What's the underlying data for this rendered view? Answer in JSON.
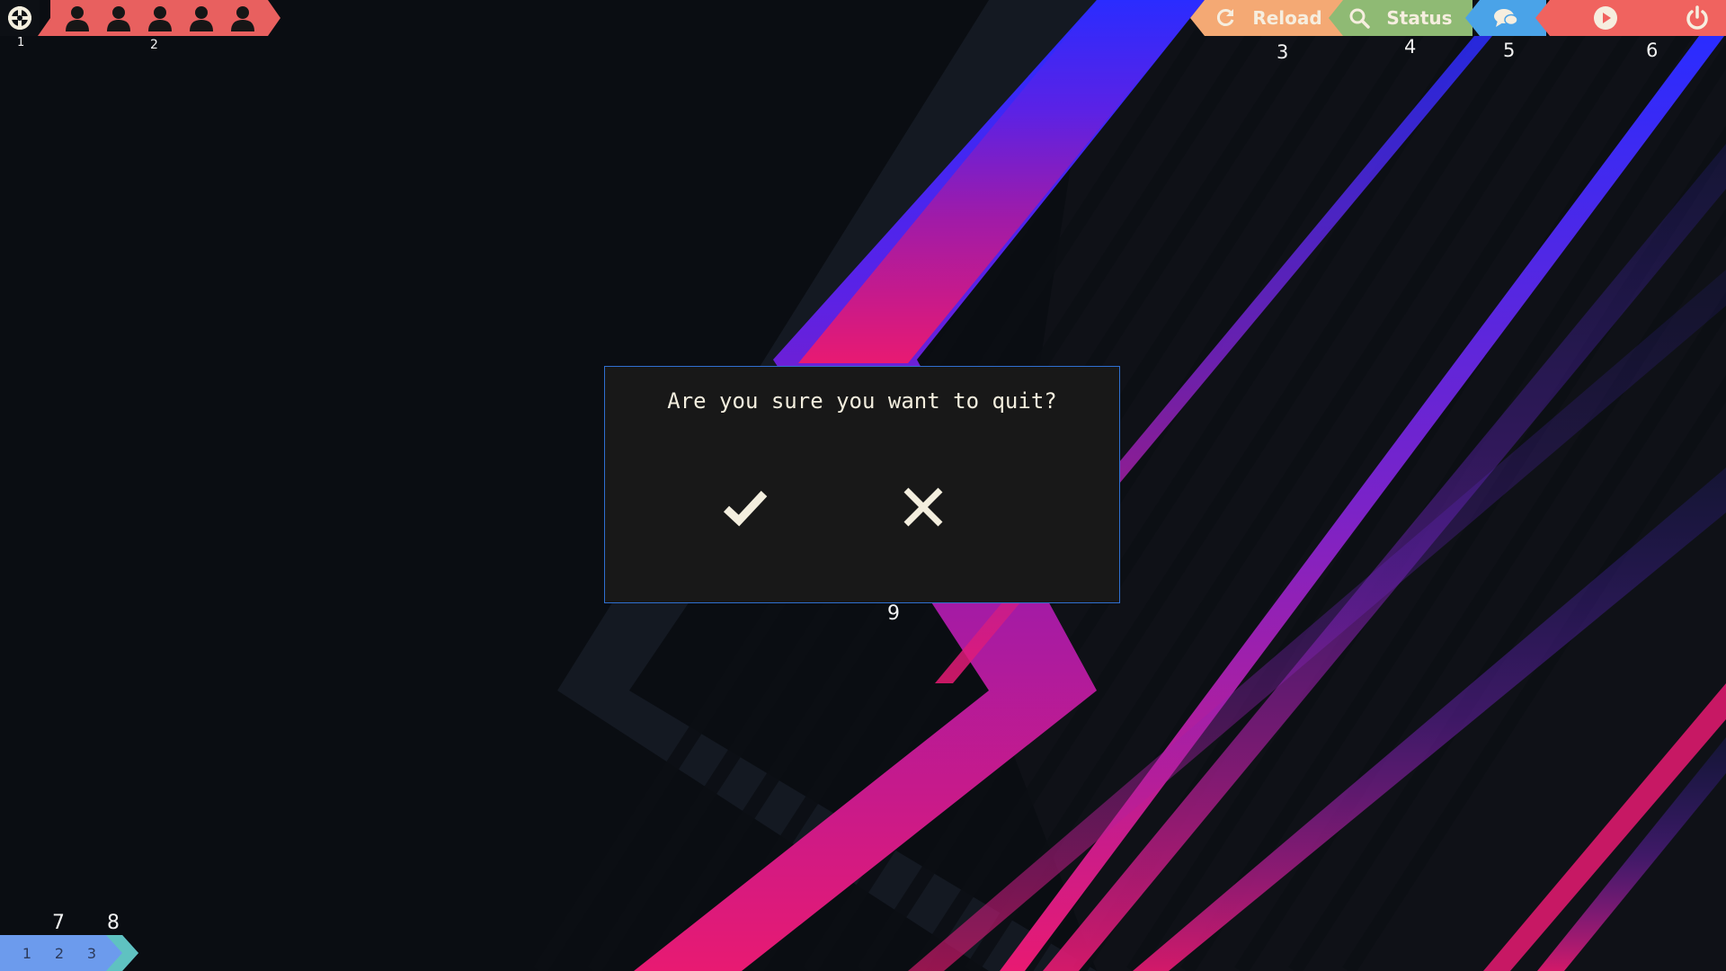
{
  "workspace_bar": {
    "markers": [
      "1",
      "2"
    ],
    "people_count": 5
  },
  "status_bar": {
    "reload_label": "Reload",
    "status_label": "Status",
    "markers": [
      "3",
      "4",
      "5",
      "6"
    ]
  },
  "dialog": {
    "title": "Are you sure you want to quit?",
    "marker": "9"
  },
  "tag_bar": {
    "tags": [
      "1",
      "2",
      "3"
    ],
    "markers": [
      "7",
      "8"
    ]
  },
  "colors": {
    "background": "#0a0d12",
    "workspace_bar": "#e8605f",
    "reload": "#f4a974",
    "status": "#8fba74",
    "chat": "#4aa3e8",
    "power": "#f0635f",
    "dialog_border": "#2f6fd0",
    "tag_bar": "#6c9bed",
    "tag_tip": "#5fc2c1"
  },
  "icons": {
    "logo": "gear-logo-icon",
    "person": "person-icon",
    "reload": "refresh-icon",
    "status": "search-icon",
    "chat": "chat-bubbles-icon",
    "play": "play-icon",
    "power": "power-icon",
    "confirm": "checkmark-icon",
    "cancel": "close-icon"
  }
}
